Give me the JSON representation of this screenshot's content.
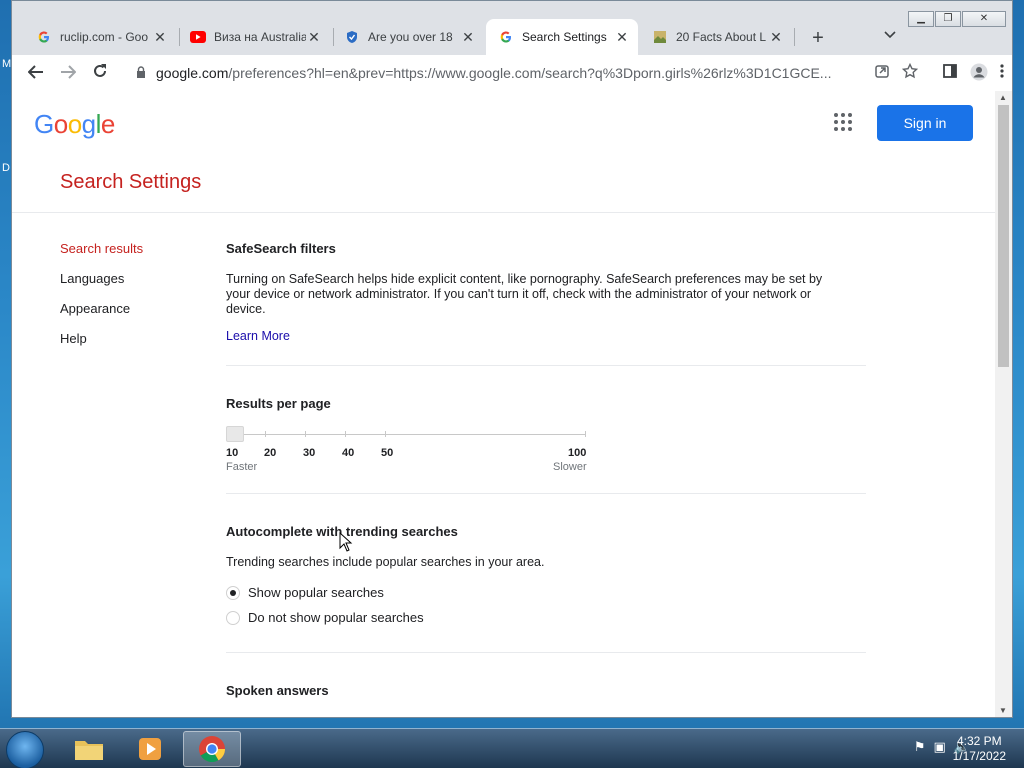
{
  "desktop": {
    "left_letters": [
      "M",
      "D"
    ]
  },
  "tabs": [
    {
      "title": "ruclip.com - Goo",
      "icon": "google-g-icon",
      "active": false
    },
    {
      "title": "Виза на Australia",
      "icon": "youtube-icon",
      "active": false
    },
    {
      "title": "Are you over 18",
      "icon": "site-shield-icon",
      "active": false
    },
    {
      "title": "Search Settings",
      "icon": "google-g-icon",
      "active": true
    },
    {
      "title": "20 Facts About L",
      "icon": "image-favicon-icon",
      "active": false
    }
  ],
  "tab_close_glyph": "✕",
  "new_tab_glyph": "+",
  "address": {
    "host": "google.com",
    "path": "/preferences?hl=en&prev=https://www.google.com/search?q%3Dporn.girls%26rlz%3D1C1GCE..."
  },
  "header": {
    "logo_letters": [
      {
        "ch": "G",
        "color": "#4285F4"
      },
      {
        "ch": "o",
        "color": "#EA4335"
      },
      {
        "ch": "o",
        "color": "#FBBC05"
      },
      {
        "ch": "g",
        "color": "#4285F4"
      },
      {
        "ch": "l",
        "color": "#34A853"
      },
      {
        "ch": "e",
        "color": "#EA4335"
      }
    ],
    "sign_in_label": "Sign in"
  },
  "page_title": "Search Settings",
  "sidebar": {
    "items": [
      {
        "label": "Search results",
        "active": true
      },
      {
        "label": "Languages",
        "active": false
      },
      {
        "label": "Appearance",
        "active": false
      },
      {
        "label": "Help",
        "active": false
      }
    ]
  },
  "safesearch": {
    "title": "SafeSearch filters",
    "description": "Turning on SafeSearch helps hide explicit content, like pornography. SafeSearch preferences may be set by your device or network administrator. If you can't turn it off, check with the administrator of your network or device.",
    "link_label": "Learn More"
  },
  "results_per_page": {
    "title": "Results per page",
    "ticks": [
      "10",
      "20",
      "30",
      "40",
      "50",
      "100"
    ],
    "selected": "10",
    "left_caption": "Faster",
    "right_caption": "Slower"
  },
  "autocomplete": {
    "title": "Autocomplete with trending searches",
    "description": "Trending searches include popular searches in your area.",
    "options": [
      {
        "label": "Show popular searches",
        "checked": true
      },
      {
        "label": "Do not show popular searches",
        "checked": false
      }
    ]
  },
  "spoken": {
    "title": "Spoken answers"
  },
  "taskbar": {
    "clock_time": "4:32 PM",
    "clock_date": "1/17/2022"
  },
  "colors": {
    "accent_red": "#c5221f",
    "sign_in_blue": "#1a73e8",
    "link_blue": "#1a0dab"
  }
}
